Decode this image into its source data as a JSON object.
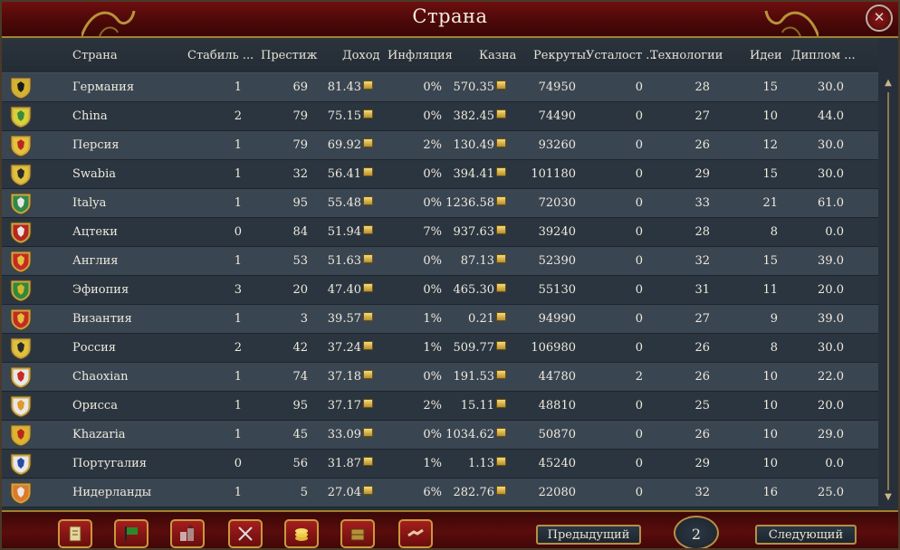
{
  "window": {
    "title": "Страна",
    "close_glyph": "✕"
  },
  "columns": [
    "Страна",
    "Стабиль ...",
    "Престиж",
    "Доход",
    "Инфляция",
    "Казна",
    "Рекруты",
    "Усталост ...",
    "Технологии",
    "Идеи",
    "Диплом ..."
  ],
  "rows": [
    {
      "country": "Германия",
      "stability": "1",
      "prestige": "69",
      "income": "81.43",
      "inflation": "0%",
      "treasury": "570.35",
      "manpower": "74950",
      "war_exhaustion": "0",
      "tech": "28",
      "ideas": "15",
      "diplo": "30.0",
      "flag_colors": [
        "#d4b42a",
        "#1a1a1a"
      ],
      "flag_icon": "eagle-shield-icon"
    },
    {
      "country": "China",
      "stability": "2",
      "prestige": "79",
      "income": "75.15",
      "inflation": "0%",
      "treasury": "382.45",
      "manpower": "74490",
      "war_exhaustion": "0",
      "tech": "27",
      "ideas": "10",
      "diplo": "44.0",
      "flag_colors": [
        "#d8d23a",
        "#3c8a3c"
      ],
      "flag_icon": "dragon-shield-icon"
    },
    {
      "country": "Персия",
      "stability": "1",
      "prestige": "79",
      "income": "69.92",
      "inflation": "2%",
      "treasury": "130.49",
      "manpower": "93260",
      "war_exhaustion": "0",
      "tech": "26",
      "ideas": "12",
      "diplo": "30.0",
      "flag_colors": [
        "#e6c23a",
        "#b8261e"
      ],
      "flag_icon": "sun-shield-icon"
    },
    {
      "country": "Swabia",
      "stability": "1",
      "prestige": "32",
      "income": "56.41",
      "inflation": "0%",
      "treasury": "394.41",
      "manpower": "101180",
      "war_exhaustion": "0",
      "tech": "29",
      "ideas": "15",
      "diplo": "30.0",
      "flag_colors": [
        "#e0c23a",
        "#2a2a2a"
      ],
      "flag_icon": "lions-shield-icon"
    },
    {
      "country": "Italya",
      "stability": "1",
      "prestige": "95",
      "income": "55.48",
      "inflation": "0%",
      "treasury": "1236.58",
      "manpower": "72030",
      "war_exhaustion": "0",
      "tech": "33",
      "ideas": "21",
      "diplo": "61.0",
      "flag_colors": [
        "#2f8a4a",
        "#e8e8e8"
      ],
      "flag_icon": "stripes-shield-icon"
    },
    {
      "country": "Ацтеки",
      "stability": "0",
      "prestige": "84",
      "income": "51.94",
      "inflation": "7%",
      "treasury": "937.63",
      "manpower": "39240",
      "war_exhaustion": "0",
      "tech": "28",
      "ideas": "8",
      "diplo": "0.0",
      "flag_colors": [
        "#b8261e",
        "#e8e8e8"
      ],
      "flag_icon": "eagle-shield-icon"
    },
    {
      "country": "Англия",
      "stability": "1",
      "prestige": "53",
      "income": "51.63",
      "inflation": "0%",
      "treasury": "87.13",
      "manpower": "52390",
      "war_exhaustion": "0",
      "tech": "32",
      "ideas": "15",
      "diplo": "39.0",
      "flag_colors": [
        "#c82a22",
        "#e0c23a"
      ],
      "flag_icon": "lions-shield-icon"
    },
    {
      "country": "Эфиопия",
      "stability": "3",
      "prestige": "20",
      "income": "47.40",
      "inflation": "0%",
      "treasury": "465.30",
      "manpower": "55130",
      "war_exhaustion": "0",
      "tech": "31",
      "ideas": "11",
      "diplo": "20.0",
      "flag_colors": [
        "#2f8a3a",
        "#d8b42a"
      ],
      "flag_icon": "lion-shield-icon"
    },
    {
      "country": "Византия",
      "stability": "1",
      "prestige": "3",
      "income": "39.57",
      "inflation": "1%",
      "treasury": "0.21",
      "manpower": "94990",
      "war_exhaustion": "0",
      "tech": "27",
      "ideas": "9",
      "diplo": "39.0",
      "flag_colors": [
        "#c82a22",
        "#e0c23a"
      ],
      "flag_icon": "cross-shield-icon"
    },
    {
      "country": "Россия",
      "stability": "2",
      "prestige": "42",
      "income": "37.24",
      "inflation": "1%",
      "treasury": "509.77",
      "manpower": "106980",
      "war_exhaustion": "0",
      "tech": "26",
      "ideas": "8",
      "diplo": "30.0",
      "flag_colors": [
        "#e0c23a",
        "#2a2a2a"
      ],
      "flag_icon": "eagle-shield-icon"
    },
    {
      "country": "Chaoxian",
      "stability": "1",
      "prestige": "74",
      "income": "37.18",
      "inflation": "0%",
      "treasury": "191.53",
      "manpower": "44780",
      "war_exhaustion": "2",
      "tech": "26",
      "ideas": "10",
      "diplo": "22.0",
      "flag_colors": [
        "#e8e8e8",
        "#c82a22"
      ],
      "flag_icon": "circle-shield-icon"
    },
    {
      "country": "Орисса",
      "stability": "1",
      "prestige": "95",
      "income": "37.17",
      "inflation": "2%",
      "treasury": "15.11",
      "manpower": "48810",
      "war_exhaustion": "0",
      "tech": "25",
      "ideas": "10",
      "diplo": "20.0",
      "flag_colors": [
        "#e8e8e8",
        "#e0982a"
      ],
      "flag_icon": "sun-shield-icon"
    },
    {
      "country": "Khazaria",
      "stability": "1",
      "prestige": "45",
      "income": "33.09",
      "inflation": "0%",
      "treasury": "1034.62",
      "manpower": "50870",
      "war_exhaustion": "0",
      "tech": "26",
      "ideas": "10",
      "diplo": "29.0",
      "flag_colors": [
        "#e0b42a",
        "#b8261e"
      ],
      "flag_icon": "trident-shield-icon"
    },
    {
      "country": "Португалия",
      "stability": "0",
      "prestige": "56",
      "income": "31.87",
      "inflation": "1%",
      "treasury": "1.13",
      "manpower": "45240",
      "war_exhaustion": "0",
      "tech": "29",
      "ideas": "10",
      "diplo": "0.0",
      "flag_colors": [
        "#e8e8e8",
        "#2a4aa8"
      ],
      "flag_icon": "quinas-shield-icon"
    },
    {
      "country": "Нидерланды",
      "stability": "1",
      "prestige": "5",
      "income": "27.04",
      "inflation": "6%",
      "treasury": "282.76",
      "manpower": "22080",
      "war_exhaustion": "0",
      "tech": "32",
      "ideas": "16",
      "diplo": "25.0",
      "flag_colors": [
        "#e0782a",
        "#e8e8e8"
      ],
      "flag_icon": "stripes-shield-icon"
    }
  ],
  "toolbar": [
    {
      "name": "ledger-button",
      "icon": "scroll-icon"
    },
    {
      "name": "flags-button",
      "icon": "flag-icon"
    },
    {
      "name": "buildings-button",
      "icon": "buildings-icon"
    },
    {
      "name": "military-button",
      "icon": "crossed-swords-icon"
    },
    {
      "name": "economy-button",
      "icon": "coins-icon"
    },
    {
      "name": "trade-button",
      "icon": "crate-icon"
    },
    {
      "name": "diplomacy-button",
      "icon": "handshake-icon"
    }
  ],
  "pager": {
    "prev_label": "Предыдущий",
    "next_label": "Следующий",
    "page": "2"
  },
  "colors": {
    "title_bar": "#5a0b0b",
    "gold_trim": "#b49045",
    "row_odd": "#3a4552",
    "row_even": "#2b3540",
    "text": "#eeeadc"
  }
}
